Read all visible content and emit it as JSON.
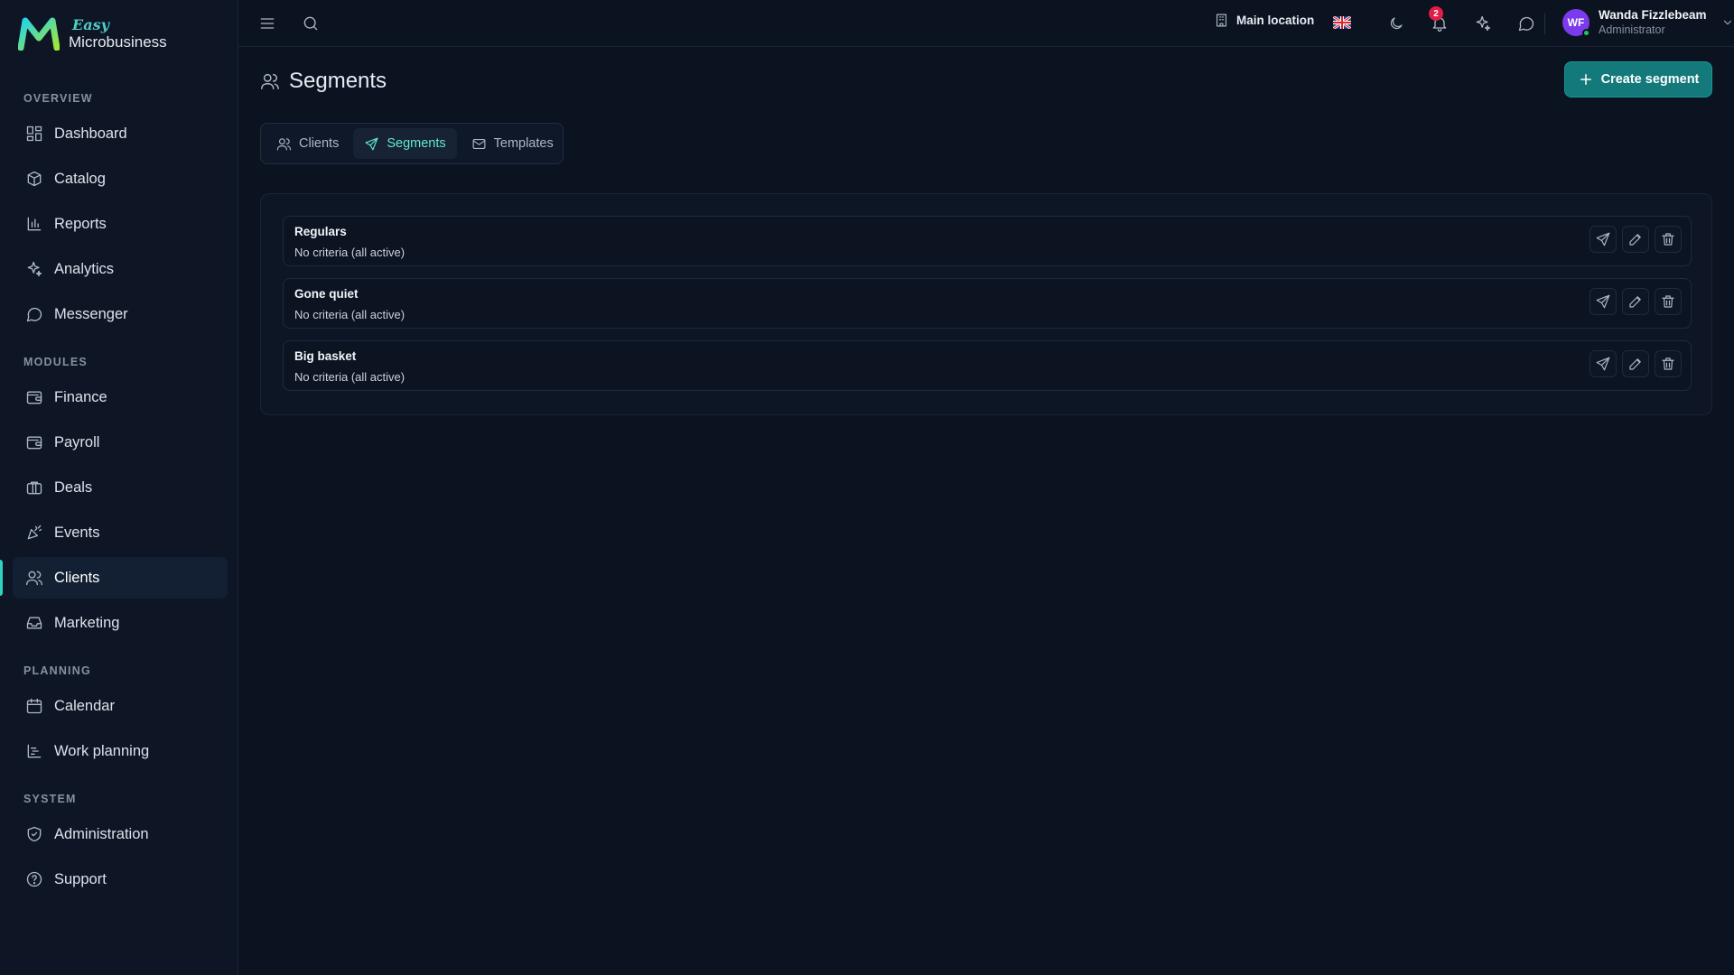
{
  "brand": {
    "easy": "Easy",
    "name": "Microbusiness"
  },
  "sidebar": {
    "sections": [
      {
        "label": "OVERVIEW"
      },
      {
        "label": "MODULES"
      },
      {
        "label": "PLANNING"
      },
      {
        "label": "SYSTEM"
      }
    ],
    "items": [
      {
        "label": "Dashboard",
        "icon": "dashboard-icon"
      },
      {
        "label": "Catalog",
        "icon": "catalog-icon"
      },
      {
        "label": "Reports",
        "icon": "reports-icon"
      },
      {
        "label": "Analytics",
        "icon": "sparkles-icon"
      },
      {
        "label": "Messenger",
        "icon": "chat-icon"
      },
      {
        "label": "Finance",
        "icon": "wallet-icon"
      },
      {
        "label": "Payroll",
        "icon": "wallet-icon"
      },
      {
        "label": "Deals",
        "icon": "briefcase-icon"
      },
      {
        "label": "Events",
        "icon": "party-icon"
      },
      {
        "label": "Clients",
        "icon": "users-icon",
        "active": true
      },
      {
        "label": "Marketing",
        "icon": "inbox-icon"
      },
      {
        "label": "Calendar",
        "icon": "calendar-icon"
      },
      {
        "label": "Work planning",
        "icon": "gantt-icon"
      },
      {
        "label": "Administration",
        "icon": "shield-icon"
      },
      {
        "label": "Support",
        "icon": "help-icon"
      }
    ]
  },
  "topbar": {
    "location": "Main location",
    "notifications_count": "2",
    "user": {
      "initials": "WF",
      "name": "Wanda Fizzlebeam",
      "role": "Administrator"
    }
  },
  "page": {
    "title": "Segments",
    "create_label": "Create segment",
    "tabs": [
      {
        "label": "Clients",
        "icon": "users-icon"
      },
      {
        "label": "Segments",
        "icon": "send-icon",
        "active": true
      },
      {
        "label": "Templates",
        "icon": "mail-icon"
      }
    ],
    "segments": [
      {
        "name": "Regulars",
        "criteria": "No criteria (all active)"
      },
      {
        "name": "Gone quiet",
        "criteria": "No criteria (all active)"
      },
      {
        "name": "Big basket",
        "criteria": "No criteria (all active)"
      }
    ]
  },
  "colors": {
    "accent": "#2dd4bf",
    "primary_button": "#14797a",
    "background": "#0b1220",
    "sidebar": "#0e1626"
  }
}
